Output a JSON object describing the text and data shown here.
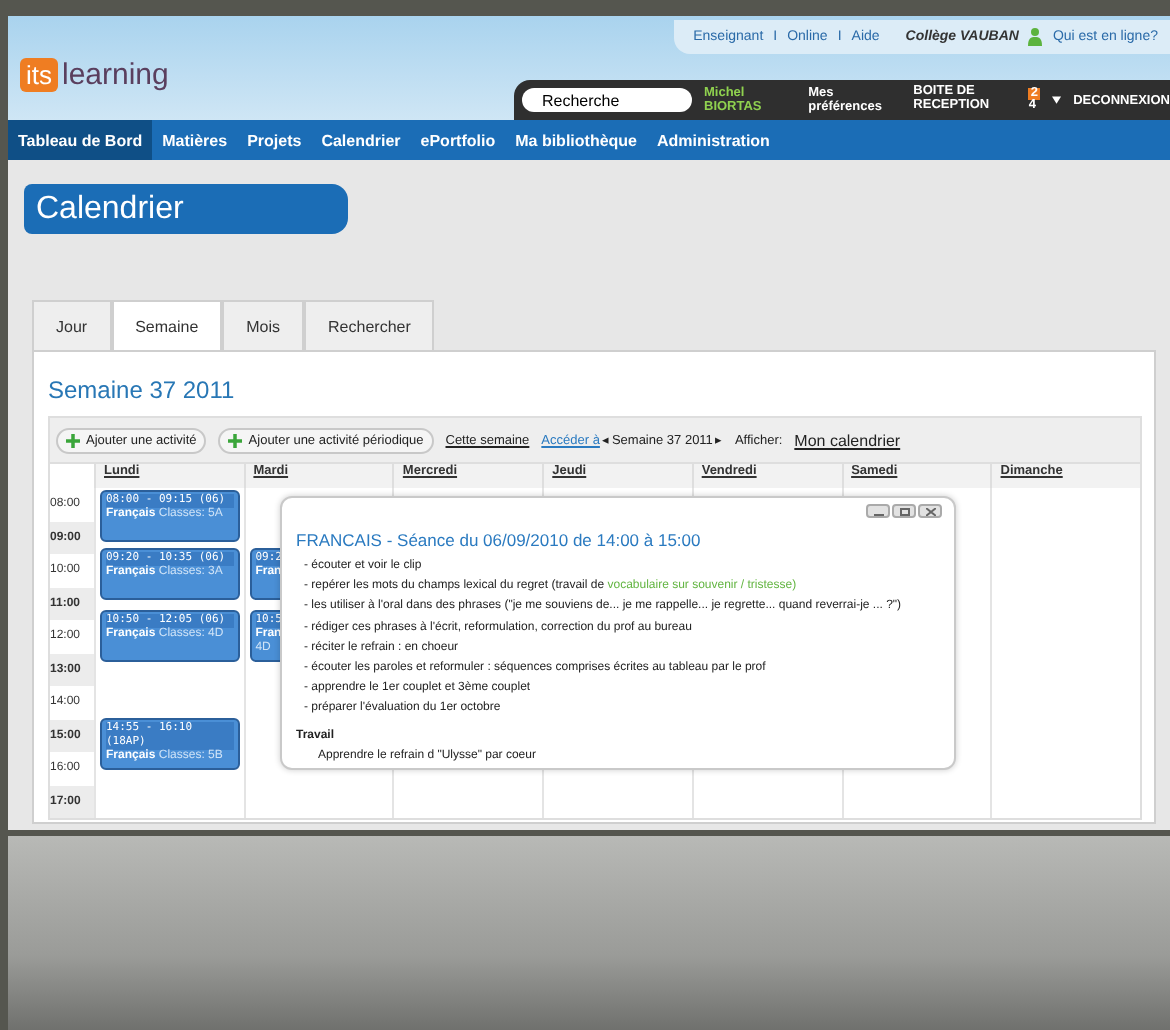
{
  "logo": {
    "badge": "its",
    "word": "learning"
  },
  "top_links": [
    {
      "label": "Enseignant"
    },
    {
      "label": "Online"
    },
    {
      "label": "Aide"
    }
  ],
  "separators": [
    "I",
    "I"
  ],
  "school": "Collège VAUBAN",
  "who_online": "Qui est en ligne?",
  "search": {
    "placeholder": "Recherche"
  },
  "user_name": "Michel BIORTAS",
  "preferences": "Mes préférences",
  "inbox": "BOITE DE RECEPTION",
  "inbox_badge": "2",
  "inbox_count": "4",
  "logout": "DECONNEXION",
  "nav": [
    {
      "label": "Tableau de Bord",
      "selected": true
    },
    {
      "label": "Matières",
      "selected": false
    },
    {
      "label": "Projets",
      "selected": false
    },
    {
      "label": "Calendrier",
      "selected": false
    },
    {
      "label": "ePortfolio",
      "selected": false
    },
    {
      "label": "Ma bibliothèque",
      "selected": false
    },
    {
      "label": "Administration",
      "selected": false
    }
  ],
  "page_title": "Calendrier",
  "tabs": [
    {
      "label": "Jour",
      "selected": false
    },
    {
      "label": "Semaine",
      "selected": true
    },
    {
      "label": "Mois",
      "selected": false
    },
    {
      "label": "Rechercher",
      "selected": false
    }
  ],
  "week_title": "Semaine 37 2011",
  "toolbar": {
    "add_activity": "Ajouter une activité",
    "add_periodic": "Ajouter une activité périodique",
    "this_week": "Cette semaine",
    "goto": "Accéder à",
    "prev": "◂",
    "week": "Semaine 37 2011",
    "next": "▸",
    "show_label": "Afficher:",
    "calendar": "Mon calendrier"
  },
  "days": [
    {
      "name": "Lundi",
      "events": [
        {
          "time": "08:00 - 09:15 (06)",
          "subject": "Français",
          "classes": "Classes: 5A"
        },
        {
          "time": "09:20 - 10:35 (06)",
          "subject": "Français",
          "classes": "Classes: 3A"
        },
        {
          "time": "10:50 - 12:05 (06)",
          "subject": "Français",
          "classes": "Classes: 4D"
        },
        {
          "time": "14:55 - 16:10 (18AP)",
          "subject": "Français",
          "classes": "Classes: 5B"
        }
      ]
    },
    {
      "name": "Mardi",
      "events": [
        {
          "time": "09:2",
          "subject": "Fran"
        },
        {
          "time": "10:5",
          "subject": "Fran",
          "classes": "4D"
        }
      ]
    },
    {
      "name": "Mercredi"
    },
    {
      "name": "Jeudi"
    },
    {
      "name": "Vendredi"
    },
    {
      "name": "Samedi"
    },
    {
      "name": "Dimanche"
    }
  ],
  "hours": [
    {
      "label": "08:00",
      "bold": false
    },
    {
      "label": "09:00",
      "bold": true
    },
    {
      "label": "10:00",
      "bold": false
    },
    {
      "label": "11:00",
      "bold": true
    },
    {
      "label": "12:00",
      "bold": false
    },
    {
      "label": "13:00",
      "bold": true
    },
    {
      "label": "14:00",
      "bold": false
    },
    {
      "label": "15:00",
      "bold": true
    },
    {
      "label": "16:00",
      "bold": false
    },
    {
      "label": "17:00",
      "bold": true
    }
  ],
  "popup": {
    "title": "FRANCAIS - Séance du 06/09/2010 de 14:00 à 15:00",
    "items": [
      {
        "text": "- écouter et voir le clip"
      },
      {
        "text": "- repérer les mots du champs lexical du regret (travail de ",
        "highlight": "vocabulaire sur souvenir / tristesse)"
      },
      {
        "text": "- les utiliser à l'oral dans des phrases (\"je me souviens de... je me rappelle... je regrette... quand reverrai-je ... ?\")"
      },
      {
        "text": "- rédiger ces phrases à l'écrit, reformulation, correction du prof au bureau"
      },
      {
        "text": "- réciter le refrain : en choeur"
      },
      {
        "text": "- écouter les paroles et reformuler : séquences comprises écrites au tableau par le prof"
      },
      {
        "text": "- apprendre le 1er couplet et 3ème couplet"
      },
      {
        "text": "- préparer l'évaluation du 1er octobre"
      }
    ],
    "work_heading": "Travail",
    "work": "Apprendre le refrain d \"Ulysse\" par coeur"
  }
}
